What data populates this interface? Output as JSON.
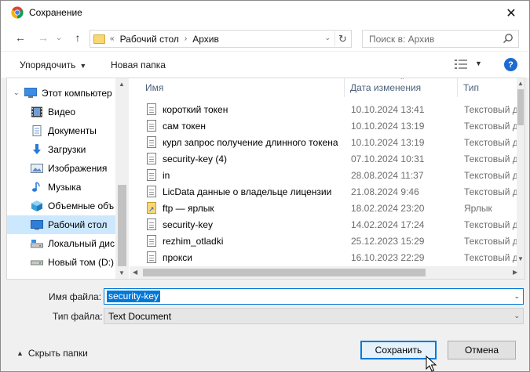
{
  "window": {
    "title": "Сохранение",
    "close_glyph": "✕"
  },
  "nav_buttons": {
    "back": "←",
    "forward": "→",
    "dropdown": "⌄",
    "up": "↑"
  },
  "address": {
    "prefix": "«",
    "crumbs": [
      "Рабочий стол",
      "Архив"
    ],
    "separator": "›",
    "refresh_glyph": "↻",
    "dropdown_glyph": "⌄"
  },
  "search": {
    "placeholder": "Поиск в: Архив",
    "icon": "search-icon"
  },
  "toolbar": {
    "organize_label": "Упорядочить",
    "new_folder_label": "Новая папка",
    "help_label": "?"
  },
  "sidebar": {
    "items": [
      {
        "label": "Этот компьютер",
        "icon": "computer-icon"
      },
      {
        "label": "Видео",
        "icon": "video-icon"
      },
      {
        "label": "Документы",
        "icon": "documents-icon"
      },
      {
        "label": "Загрузки",
        "icon": "downloads-icon"
      },
      {
        "label": "Изображения",
        "icon": "pictures-icon"
      },
      {
        "label": "Музыка",
        "icon": "music-icon"
      },
      {
        "label": "Объемные объ",
        "icon": "3d-objects-icon"
      },
      {
        "label": "Рабочий стол",
        "icon": "desktop-icon"
      },
      {
        "label": "Локальный дис",
        "icon": "local-disk-icon"
      },
      {
        "label": "Новый том (D:)",
        "icon": "drive-icon"
      }
    ],
    "selected_index": 7
  },
  "columns": {
    "name": "Имя",
    "date": "Дата изменения",
    "type": "Тип"
  },
  "files": [
    {
      "name": "короткий токен",
      "date": "10.10.2024 13:41",
      "type": "Текстовый д"
    },
    {
      "name": "сам токен",
      "date": "10.10.2024 13:19",
      "type": "Текстовый д"
    },
    {
      "name": "курл запрос получение длинного токена",
      "date": "10.10.2024 13:19",
      "type": "Текстовый д"
    },
    {
      "name": "security-key (4)",
      "date": "07.10.2024 10:31",
      "type": "Текстовый д"
    },
    {
      "name": "in",
      "date": "28.08.2024 11:37",
      "type": "Текстовый д"
    },
    {
      "name": "LicData данные о владельце лицензии",
      "date": "21.08.2024 9:46",
      "type": "Текстовый д"
    },
    {
      "name": "ftp — ярлык",
      "date": "18.02.2024 23:20",
      "type": "Ярлык",
      "shortcut": true
    },
    {
      "name": "security-key",
      "date": "14.02.2024 17:24",
      "type": "Текстовый д"
    },
    {
      "name": "rezhim_otladki",
      "date": "25.12.2023 15:29",
      "type": "Текстовый д"
    },
    {
      "name": "прокси",
      "date": "16.10.2023 22:29",
      "type": "Текстовый д"
    }
  ],
  "form": {
    "filename_label": "Имя файла:",
    "filename_value": "security-key",
    "filetype_label": "Тип файла:",
    "filetype_value": "Text Document"
  },
  "footer": {
    "hide_folders_label": "Скрыть папки",
    "save_label": "Сохранить",
    "cancel_label": "Отмена"
  },
  "colors": {
    "accent": "#0078d7",
    "selection": "#cce8ff",
    "help": "#1c6bd0"
  }
}
